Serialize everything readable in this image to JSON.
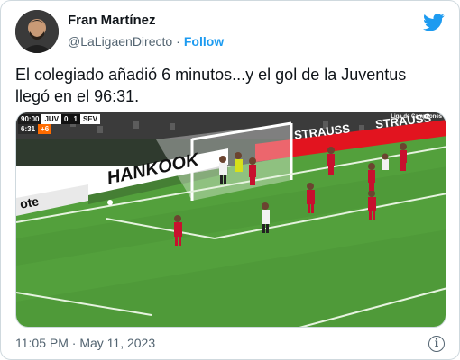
{
  "author": {
    "name": "Fran Martínez",
    "handle": "@LaLigaenDirecto",
    "follow_label": "Follow"
  },
  "tweet": {
    "text_line1": "El colegiado añadió 6 minutos...y el gol de la Juventus",
    "text_line2": "llegó en el 96:31.",
    "timestamp": "11:05 PM · May 11, 2023"
  },
  "media": {
    "time": "90:00",
    "home": "JUV",
    "home_goals": "0",
    "away_goals": "1",
    "away": "SEV",
    "clock": "6:31",
    "added": "+6",
    "ad_strauss": "STRAUSS",
    "ad_hankook": "HANKOOK",
    "ad_ote": "ote",
    "channel": "Liga de Campeones"
  },
  "colors": {
    "twitter_blue": "#1d9bf0",
    "pitch": "#4f9a39",
    "sevilla_kit": "#c8102e"
  },
  "icons": {
    "brand": "twitter-bird-icon",
    "info": "info-icon"
  }
}
